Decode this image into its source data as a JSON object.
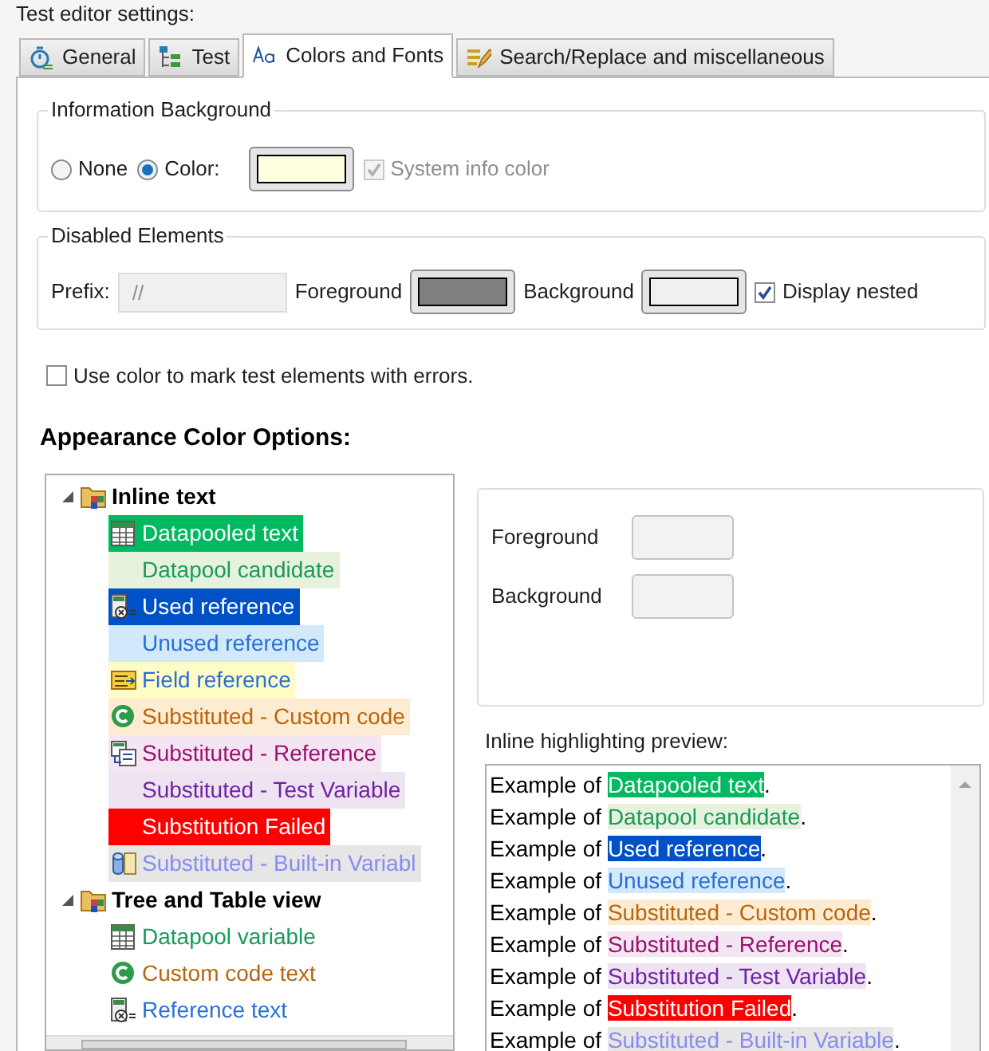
{
  "heading": "Test editor settings:",
  "tabs": [
    {
      "label": "General",
      "kind": "stopwatch",
      "selected": false
    },
    {
      "label": "Test",
      "kind": "tree",
      "selected": false
    },
    {
      "label": "Colors and Fonts",
      "kind": "font",
      "selected": true
    },
    {
      "label": "Search/Replace and miscellaneous",
      "kind": "pencil",
      "selected": false
    }
  ],
  "information_background": {
    "title": "Information Background",
    "options": [
      {
        "label": "None",
        "selected": false
      },
      {
        "label": "Color:",
        "selected": true
      }
    ],
    "swatch": {
      "color": "#ffffe1"
    },
    "system_info_color": {
      "label": "System info color",
      "checked": true,
      "disabled": true
    }
  },
  "disabled_elements": {
    "title": "Disabled Elements",
    "prefix_label": "Prefix:",
    "prefix_value": "//",
    "foreground_label": "Foreground",
    "foreground_swatch": {
      "color": "#808080"
    },
    "background_label": "Background",
    "background_swatch": {
      "color": "#f0f0f0"
    },
    "display_nested": {
      "label": "Display nested",
      "checked": true
    }
  },
  "error_marking": {
    "label": "Use color to mark test elements with errors.",
    "checked": false
  },
  "appearance_heading": "Appearance Color Options:",
  "tree": [
    {
      "label": "Inline text",
      "expanded": true,
      "children": [
        {
          "label": "Datapooled text",
          "kind": "datapooled",
          "color": "#00b960"
        },
        {
          "label": "Datapool candidate",
          "kind": "candidate",
          "color": "#e6f2dc"
        },
        {
          "label": "Used reference",
          "kind": "used_reference",
          "color": "#0050c8"
        },
        {
          "label": "Unused reference",
          "kind": "unused_reference",
          "color": "#d2e9fb"
        },
        {
          "label": "Field reference",
          "kind": "field_reference",
          "color": "#fffcc8"
        },
        {
          "label": "Substituted - Custom code",
          "kind": "custom_code",
          "color": "#fdebd2"
        },
        {
          "label": "Substituted - Reference",
          "kind": "substituted_reference",
          "color": "#f3e6f2"
        },
        {
          "label": "Substituted - Test Variable",
          "kind": "test_variable",
          "color": "#eee3f0"
        },
        {
          "label": "Substitution Failed",
          "kind": "failed",
          "color": "#ff0000"
        },
        {
          "label": "Substituted - Built-in Variabl",
          "kind": "builtin",
          "color": "#e6e6e6"
        }
      ]
    },
    {
      "label": "Tree and Table view",
      "expanded": true,
      "children": [
        {
          "label": "Datapool variable",
          "kind": "datapool_variable",
          "color": "#189a5a"
        },
        {
          "label": "Custom code text",
          "kind": "custom_text",
          "color": "#b8660e"
        },
        {
          "label": "Reference text",
          "kind": "reference_text",
          "color": "#2a6fd6"
        }
      ]
    }
  ],
  "item_colors": {
    "foreground_label": "Foreground",
    "background_label": "Background"
  },
  "preview": {
    "label": "Inline highlighting preview:",
    "lines": [
      {
        "before": "Example of ",
        "highlight": "Datapooled text",
        "after": ".",
        "kind": "datapooled",
        "color": "#00b960"
      },
      {
        "before": "Example of ",
        "highlight": "Datapool candidate",
        "after": ".",
        "kind": "candidate",
        "color": "#e6f2dc"
      },
      {
        "before": "Example of ",
        "highlight": "Used reference",
        "after": ".",
        "kind": "used_reference",
        "color": "#0050c8"
      },
      {
        "before": "Example of ",
        "highlight": "Unused reference",
        "after": ".",
        "kind": "unused_reference",
        "color": "#d2e9fb"
      },
      {
        "before": "Example of ",
        "highlight": "Substituted - Custom code",
        "after": ".",
        "kind": "custom_code",
        "color": "#fdebd2"
      },
      {
        "before": "Example of ",
        "highlight": "Substituted - Reference",
        "after": ".",
        "kind": "substituted_reference",
        "color": "#f3e6f2"
      },
      {
        "before": "Example of ",
        "highlight": "Substituted - Test Variable",
        "after": ".",
        "kind": "test_variable",
        "color": "#eee3f0"
      },
      {
        "before": "Example of ",
        "highlight": "Substitution Failed",
        "after": ".",
        "kind": "failed",
        "color": "#ff0000"
      },
      {
        "before": "Example of ",
        "highlight": "Substituted - Built-in Variable",
        "after": ".",
        "kind": "builtin",
        "color": "#e6e6e6"
      }
    ]
  }
}
